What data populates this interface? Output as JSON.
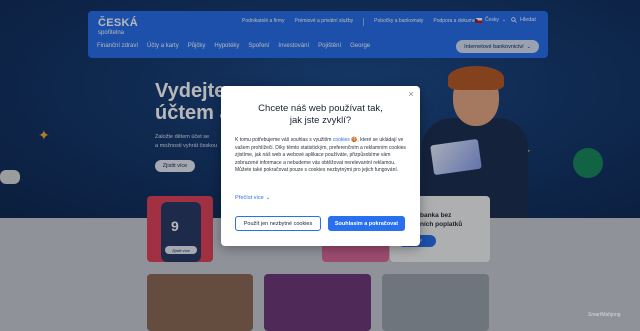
{
  "header": {
    "logo_line1": "ČESKÁ",
    "logo_line2": "spořitelna",
    "top_links": [
      "Podnikatelé a firmy",
      "Prémiové a privátní služby",
      "Pobočky a bankomaty",
      "Podpora a dokumenty"
    ],
    "language": "Česky",
    "search_label": "Hledat",
    "nav": [
      "Finanční zdraví",
      "Účty a karty",
      "Půjčky",
      "Hypotéky",
      "Spoření",
      "Investování",
      "Pojištění",
      "George"
    ],
    "internet_banking_label": "Internetové bankovnictví"
  },
  "hero": {
    "title_line1": "Vydejte",
    "title_line2": "účtem a",
    "text_line1": "Založte dětem účet se",
    "text_line2": "a možnosti vyhrát českou",
    "button_label": "Zjistit více"
  },
  "cards": {
    "phone_button": "Zjistit více",
    "right_text_line1": "banka bez",
    "right_text_line2": "ních poplatků",
    "right_button": "více"
  },
  "modal": {
    "title_line1": "Chcete náš web používat tak,",
    "title_line2": "jak jste zvyklí?",
    "body_before": "K tomu potřebujeme váš souhlas s využitím ",
    "body_link": "cookies",
    "body_after": " 🍪, které se ukládají ve vašem prohlížeči. Díky těmto statistickým, preferenčním a reklamním cookies zjistíme, jak náš web a webové aplikace používáte, přizpůsobíme vám zobrazené informace a nebudeme vás obtěžovat nerelevantní reklamou. Můžete také pokračovat pouze s cookies nezbytnými pro jejich fungování.",
    "more_label": "Přečíst více",
    "btn_necessary": "Použít jen nezbytné cookies",
    "btn_accept": "Souhlasím a pokračovat",
    "close_symbol": "×"
  },
  "colors": {
    "brand_blue": "#2870ed",
    "overlay": "rgba(0,0,0,0.28)"
  },
  "watermark": "SmartMahjong"
}
